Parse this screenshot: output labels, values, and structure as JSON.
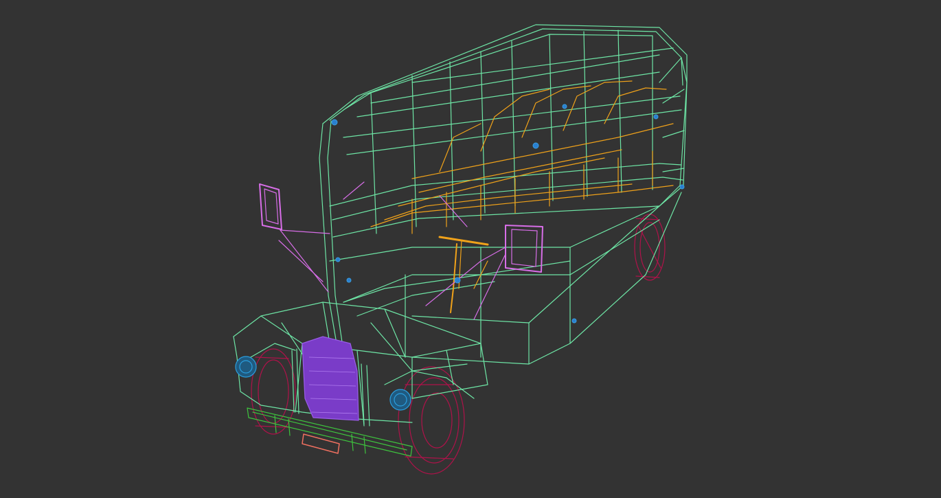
{
  "viewport": {
    "background": "#333333",
    "render_mode": "wireframe"
  },
  "model": {
    "subject": "bus",
    "parts": [
      {
        "name": "body-shell",
        "color": "#6ee6a6"
      },
      {
        "name": "interior-seats",
        "color": "#f0a21a"
      },
      {
        "name": "mirrors-and-rails",
        "color": "#d86ee8"
      },
      {
        "name": "radiator-grille",
        "color": "#7a3cc8"
      },
      {
        "name": "wheels",
        "color": "#b0124a"
      },
      {
        "name": "bumper",
        "color": "#3ec43e"
      },
      {
        "name": "license-plate",
        "color": "#f07060"
      },
      {
        "name": "headlights-and-markers",
        "color": "#2a7fd0"
      }
    ]
  }
}
